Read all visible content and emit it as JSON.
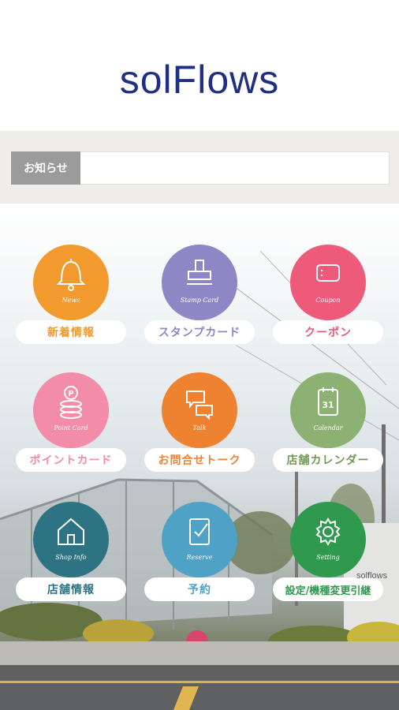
{
  "app": {
    "logo": "solFlows"
  },
  "notice": {
    "label": "お知らせ",
    "text": ""
  },
  "menu": [
    {
      "label": "新着情報",
      "sublabel": "News",
      "icon": "bell-icon",
      "color": "#f29a2e",
      "text_color": "#f29a2e"
    },
    {
      "label": "スタンプカード",
      "sublabel": "Stamp Card",
      "icon": "stamp-icon",
      "color": "#8f86c6",
      "text_color": "#8f86c6"
    },
    {
      "label": "クーポン",
      "sublabel": "Coupon",
      "icon": "coupon-icon",
      "color": "#ee5a7a",
      "text_color": "#ee5a7a"
    },
    {
      "label": "ポイントカード",
      "sublabel": "Point Card",
      "icon": "coin-stack-icon",
      "color": "#f28ca8",
      "text_color": "#f28ca8"
    },
    {
      "label": "お問合せトーク",
      "sublabel": "Talk",
      "icon": "chat-icon",
      "color": "#ee8230",
      "text_color": "#ee8230"
    },
    {
      "label": "店舗カレンダー",
      "sublabel": "Calendar",
      "icon": "calendar-icon",
      "color": "#8cb173",
      "text_color": "#6f9a55"
    },
    {
      "label": "店舗情報",
      "sublabel": "Shop Info",
      "icon": "house-icon",
      "color": "#2d7383",
      "text_color": "#2d7383"
    },
    {
      "label": "予約",
      "sublabel": "Reserve",
      "icon": "checklist-icon",
      "color": "#4fa1c6",
      "text_color": "#4fa1c6"
    },
    {
      "label": "設定/機種変更引継",
      "sublabel": "Setting",
      "icon": "gear-icon",
      "color": "#2f9a4e",
      "text_color": "#2f9a4e"
    }
  ],
  "calendar_day": "31",
  "watermark": "solflows"
}
